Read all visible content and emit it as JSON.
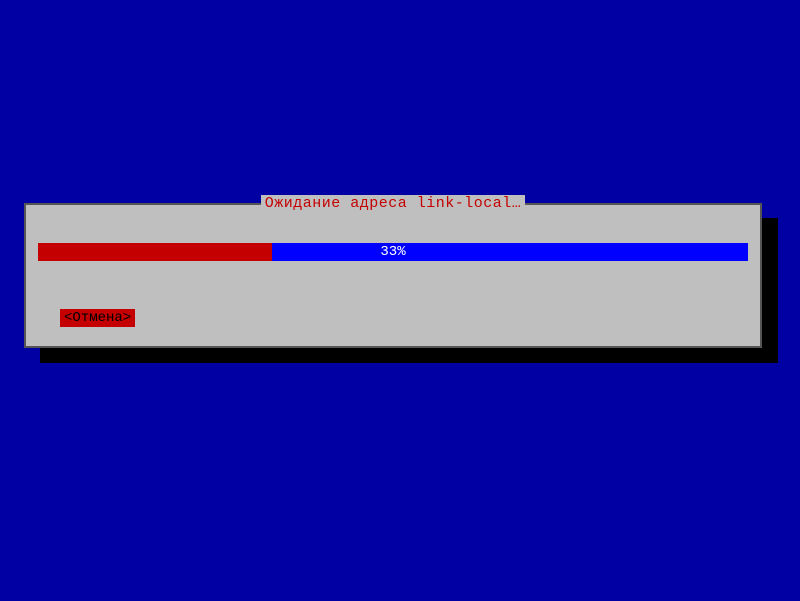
{
  "dialog": {
    "title": "Ожидание адреса link-local…",
    "progress": {
      "percent": 33,
      "label": "33%"
    },
    "cancel_label": "<Отмена>"
  },
  "colors": {
    "background": "#0000a3",
    "panel": "#bfbfbf",
    "border": "#555555",
    "accent_red": "#c40000",
    "bar_blue": "#0000ff",
    "shadow": "#000000"
  }
}
